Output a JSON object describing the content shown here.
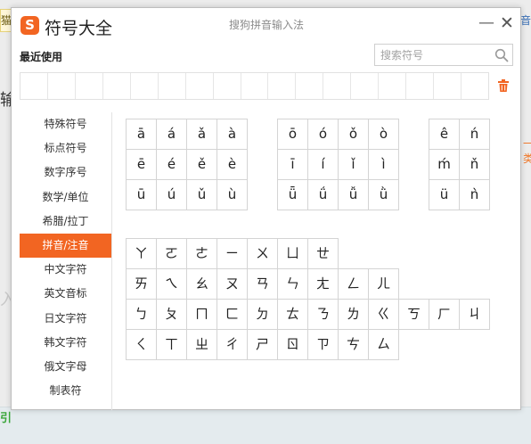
{
  "background": {
    "top_left_text": "猫",
    "top_right_text": "音",
    "left_text_1": "输",
    "left_text_2": "入",
    "left_text_3": "引",
    "right_text_1": "一类"
  },
  "dialog": {
    "logo_text": "S",
    "title": "符号大全",
    "app_name": "搜狗拼音输入法",
    "minimize_symbol": "—",
    "close_symbol": "✕",
    "recent_label": "最近使用",
    "search_placeholder": "搜索符号",
    "accent_color": "#f26522"
  },
  "sidebar": {
    "items": [
      {
        "label": "特殊符号",
        "active": false
      },
      {
        "label": "标点符号",
        "active": false
      },
      {
        "label": "数字序号",
        "active": false
      },
      {
        "label": "数学/单位",
        "active": false
      },
      {
        "label": "希腊/拉丁",
        "active": false
      },
      {
        "label": "拼音/注音",
        "active": true
      },
      {
        "label": "中文字符",
        "active": false
      },
      {
        "label": "英文音标",
        "active": false
      },
      {
        "label": "日文字符",
        "active": false
      },
      {
        "label": "韩文字符",
        "active": false
      },
      {
        "label": "俄文字母",
        "active": false
      },
      {
        "label": "制表符",
        "active": false
      }
    ]
  },
  "pinyin": {
    "group_a": [
      "ā",
      "á",
      "ǎ",
      "à",
      "ē",
      "é",
      "ě",
      "è",
      "ū",
      "ú",
      "ǔ",
      "ù"
    ],
    "group_b": [
      "ō",
      "ó",
      "ǒ",
      "ò",
      "ī",
      "í",
      "ǐ",
      "ì",
      "ǖ",
      "ǘ",
      "ǚ",
      "ǜ"
    ],
    "group_c": [
      "ê",
      "ń",
      "ḿ",
      "ň",
      "ü",
      "ǹ"
    ]
  },
  "zhuyin": {
    "row1": [
      "ㄚ",
      "ㄛ",
      "ㄜ",
      "ㄧ",
      "ㄨ",
      "ㄩ",
      "ㄝ"
    ],
    "row2": [
      "ㄞ",
      "ㄟ",
      "ㄠ",
      "ㄡ",
      "ㄢ",
      "ㄣ",
      "ㄤ",
      "ㄥ",
      "ㄦ"
    ],
    "row3": [
      "ㄅ",
      "ㄆ",
      "ㄇ",
      "ㄈ",
      "ㄉ",
      "ㄊ",
      "ㄋ",
      "ㄌ",
      "ㄍ",
      "ㄎ",
      "ㄏ",
      "ㄐ"
    ],
    "row4": [
      "ㄑ",
      "ㄒ",
      "ㄓ",
      "ㄔ",
      "ㄕ",
      "ㄖ",
      "ㄗ",
      "ㄘ",
      "ㄙ"
    ]
  }
}
